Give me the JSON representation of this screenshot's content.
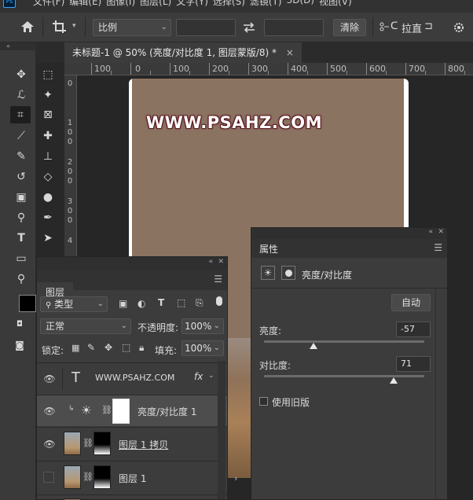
{
  "menubar": {
    "items": [
      "文件(F)",
      "编辑(E)",
      "图像(I)",
      "图层(L)",
      "文字(Y)",
      "选择(S)",
      "滤镜(T)",
      "3D(D)",
      "视图(V)"
    ]
  },
  "options": {
    "ratio_label": "比例",
    "clear_label": "清除",
    "straighten_label": "拉直"
  },
  "document": {
    "tab_title": "未标题-1 @ 50% (亮度/对比度 1, 图层蒙版/8) *",
    "close_glyph": "×",
    "watermark": "WWW.PSAHZ.COM"
  },
  "ruler": {
    "h_labels": [
      "100",
      "0",
      "100",
      "200",
      "300",
      "400",
      "500",
      "600",
      "700",
      "800"
    ],
    "v_labels": [
      "0",
      "1",
      "0",
      "0",
      "2",
      "0",
      "0",
      "3",
      "0",
      "0",
      "4"
    ]
  },
  "layers": {
    "tab_label": "图层",
    "filter_kind": "类型",
    "blend_mode": "正常",
    "opacity_label": "不透明度:",
    "opacity_value": "100%",
    "lock_label": "锁定:",
    "fill_label": "填充:",
    "fill_value": "100%",
    "items": [
      {
        "name": "WWW.PSAHZ.COM",
        "fx": "fx",
        "type_glyph": "T"
      },
      {
        "name": "亮度/对比度 1"
      },
      {
        "name": "图层 1 拷贝"
      },
      {
        "name": "图层 1"
      }
    ]
  },
  "properties": {
    "tab_label": "属性",
    "adjustment_name": "亮度/对比度",
    "auto_label": "自动",
    "brightness_label": "亮度:",
    "brightness_value": "-57",
    "brightness": -57,
    "contrast_label": "对比度:",
    "contrast_value": "71",
    "contrast": 71,
    "legacy_label": "使用旧版"
  },
  "colors": {
    "doc_fill": "#8b7361",
    "panel_bg": "#3c3c3c",
    "watermark_stroke": "#5a1820"
  }
}
